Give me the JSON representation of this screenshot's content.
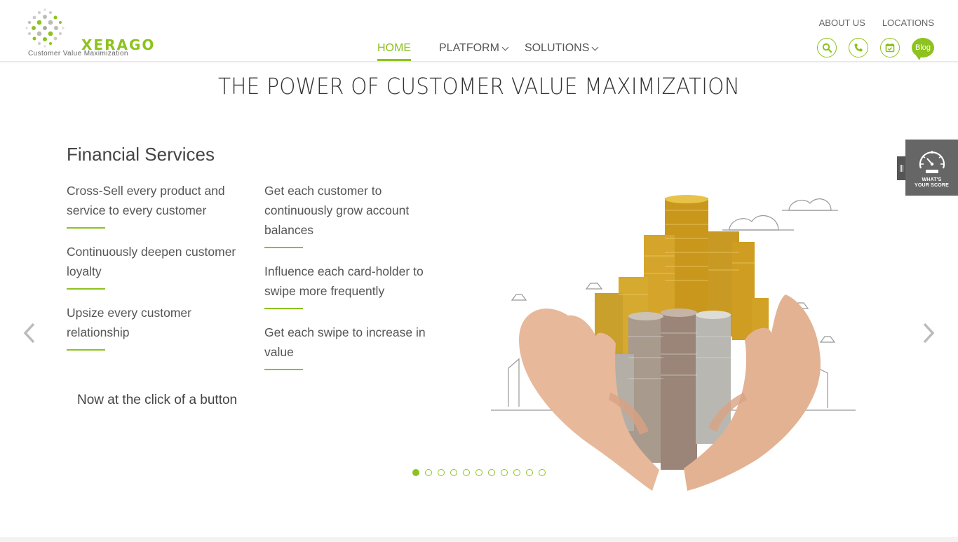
{
  "brand": {
    "name": "XERAGO",
    "tagline": "Customer Value Maximization",
    "accent": "#8dc21f"
  },
  "top_links": [
    {
      "label": "ABOUT US"
    },
    {
      "label": "LOCATIONS"
    }
  ],
  "main_nav": [
    {
      "label": "HOME",
      "active": true
    },
    {
      "label": "PLATFORM",
      "has_dropdown": true
    },
    {
      "label": "SOLUTIONS",
      "has_dropdown": true
    }
  ],
  "header_icons": [
    {
      "name": "search-icon"
    },
    {
      "name": "phone-icon"
    },
    {
      "name": "calendar-icon"
    },
    {
      "name": "blog-icon",
      "label": "Blog"
    }
  ],
  "hero": {
    "title": "THE POWER OF CUSTOMER VALUE MAXIMIZATION",
    "section_title": "Financial Services",
    "left_features": [
      "Cross-Sell every product and service to every customer",
      "Continuously deepen customer loyalty",
      "Upsize every customer relationship"
    ],
    "right_features": [
      "Get each customer to continuously grow account balances",
      "Influence each card-holder to swipe more frequently",
      "Get each swipe to increase in value"
    ],
    "cta": "Now at the click of a button",
    "slide_count": 11,
    "active_slide": 1
  },
  "score_widget": {
    "line1": "WHAT'S",
    "line2": "YOUR SCORE"
  }
}
